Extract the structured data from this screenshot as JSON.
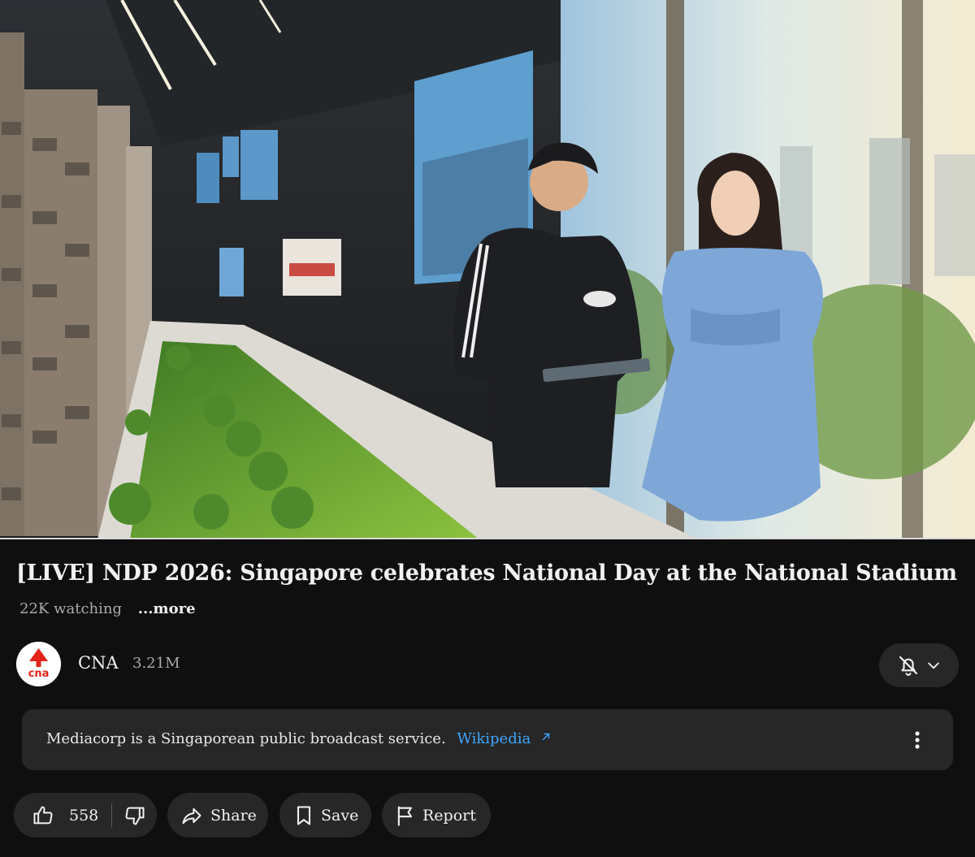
{
  "video": {
    "thumbnail_icon": "video-frame-illustration"
  },
  "title": "[LIVE] NDP 2026: Singapore celebrates National Day at the National Stadium",
  "meta": {
    "watching": "22K watching",
    "more": "...more"
  },
  "channel": {
    "name": "CNA",
    "subscribers": "3.21M",
    "logo_text": "cna",
    "brand_color": "#e2231a"
  },
  "notification": {
    "icon": "bell-off-icon",
    "chevron": "chevron-down-icon"
  },
  "info_card": {
    "text": "Mediacorp is a Singaporean public broadcast service.",
    "link_label": "Wikipedia",
    "link_icon": "external-link-icon",
    "link_color": "#3ea6ff"
  },
  "actions": {
    "like_count": "558",
    "share_label": "Share",
    "save_label": "Save",
    "report_label": "Report"
  }
}
